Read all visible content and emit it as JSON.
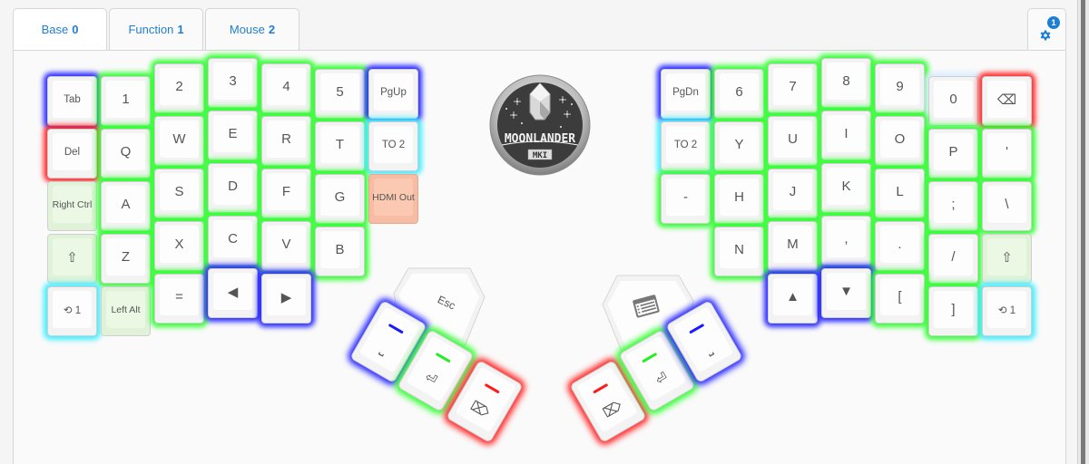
{
  "tabs": [
    {
      "label": "Base",
      "num": "0",
      "active": true
    },
    {
      "label": "Function",
      "num": "1",
      "active": false
    },
    {
      "label": "Mouse",
      "num": "2",
      "active": false
    }
  ],
  "settings": {
    "icon": "gear-icon",
    "badge": "1"
  },
  "colors": {
    "accent": "#1f7fd0",
    "green": "#33ff33",
    "blue": "#2a2aff",
    "red": "#ff2a2a",
    "cyan": "#44eeff",
    "salmon": "#f7bca4",
    "mod_green": "#e0f2d8"
  },
  "logo": {
    "text": "MOONLANDER",
    "sub": "MKI"
  },
  "left": {
    "keys": [
      {
        "label": "Tab",
        "glow": "blue"
      },
      {
        "label": "1",
        "glow": "green"
      },
      {
        "label": "2",
        "glow": "green"
      },
      {
        "label": "3",
        "glow": "green"
      },
      {
        "label": "4",
        "glow": "green"
      },
      {
        "label": "5",
        "glow": "green"
      },
      {
        "label": "PgUp",
        "glow": "blue"
      },
      {
        "label": "Del",
        "glow": "red"
      },
      {
        "label": "Q",
        "glow": "green"
      },
      {
        "label": "W",
        "glow": "green"
      },
      {
        "label": "E",
        "glow": "green"
      },
      {
        "label": "R",
        "glow": "green"
      },
      {
        "label": "T",
        "glow": "green"
      },
      {
        "label": "TO 2",
        "glow": "cyan"
      },
      {
        "label": "Right Ctrl",
        "glow": "none"
      },
      {
        "label": "A",
        "glow": "green"
      },
      {
        "label": "S",
        "glow": "green"
      },
      {
        "label": "D",
        "glow": "green"
      },
      {
        "label": "F",
        "glow": "green"
      },
      {
        "label": "G",
        "glow": "green"
      },
      {
        "label": "HDMI Out",
        "glow": "none"
      },
      {
        "label": "⇧",
        "glow": "none"
      },
      {
        "label": "Z",
        "glow": "green"
      },
      {
        "label": "X",
        "glow": "green"
      },
      {
        "label": "C",
        "glow": "green"
      },
      {
        "label": "V",
        "glow": "green"
      },
      {
        "label": "B",
        "glow": "green"
      },
      {
        "label": "⟲ 1",
        "glow": "cyan"
      },
      {
        "label": "Left Alt",
        "glow": "none"
      },
      {
        "label": "=",
        "glow": "green"
      },
      {
        "label": "◀",
        "glow": "blue"
      },
      {
        "label": "▶",
        "glow": "blue"
      }
    ],
    "thumb": {
      "hex_label": "Esc",
      "keys": [
        {
          "glyph": "⎵",
          "name": "space",
          "bar": "blue"
        },
        {
          "glyph": "⏎",
          "name": "enter",
          "bar": "green"
        },
        {
          "glyph": "⌦",
          "name": "delete",
          "bar": "red"
        }
      ]
    }
  },
  "right": {
    "keys": [
      {
        "label": "PgDn",
        "glow": "blue"
      },
      {
        "label": "6",
        "glow": "green"
      },
      {
        "label": "7",
        "glow": "green"
      },
      {
        "label": "8",
        "glow": "green"
      },
      {
        "label": "9",
        "glow": "green"
      },
      {
        "label": "0",
        "glow": "lightblue"
      },
      {
        "label": "⌫",
        "glow": "red"
      },
      {
        "label": "TO 2",
        "glow": "cyan"
      },
      {
        "label": "Y",
        "glow": "green"
      },
      {
        "label": "U",
        "glow": "green"
      },
      {
        "label": "I",
        "glow": "green"
      },
      {
        "label": "O",
        "glow": "green"
      },
      {
        "label": "P",
        "glow": "green"
      },
      {
        "label": "'",
        "glow": "green"
      },
      {
        "label": "-",
        "glow": "green"
      },
      {
        "label": "H",
        "glow": "green"
      },
      {
        "label": "J",
        "glow": "green"
      },
      {
        "label": "K",
        "glow": "green"
      },
      {
        "label": "L",
        "glow": "green"
      },
      {
        "label": ";",
        "glow": "green"
      },
      {
        "label": "\\",
        "glow": "green"
      },
      {
        "label": "N",
        "glow": "green"
      },
      {
        "label": "M",
        "glow": "green"
      },
      {
        "label": ",",
        "glow": "green"
      },
      {
        "label": ".",
        "glow": "green"
      },
      {
        "label": "/",
        "glow": "green"
      },
      {
        "label": "⇧",
        "glow": "none"
      },
      {
        "label": "▲",
        "glow": "blue"
      },
      {
        "label": "▼",
        "glow": "blue"
      },
      {
        "label": "[",
        "glow": "green"
      },
      {
        "label": "]",
        "glow": "green"
      },
      {
        "label": "⟲ 1",
        "glow": "cyan"
      }
    ],
    "thumb": {
      "hex_label": "menu-icon",
      "keys": [
        {
          "glyph": "⌦",
          "name": "delete",
          "bar": "red"
        },
        {
          "glyph": "⏎",
          "name": "enter",
          "bar": "green"
        },
        {
          "glyph": "⎵",
          "name": "space",
          "bar": "blue"
        }
      ]
    }
  }
}
